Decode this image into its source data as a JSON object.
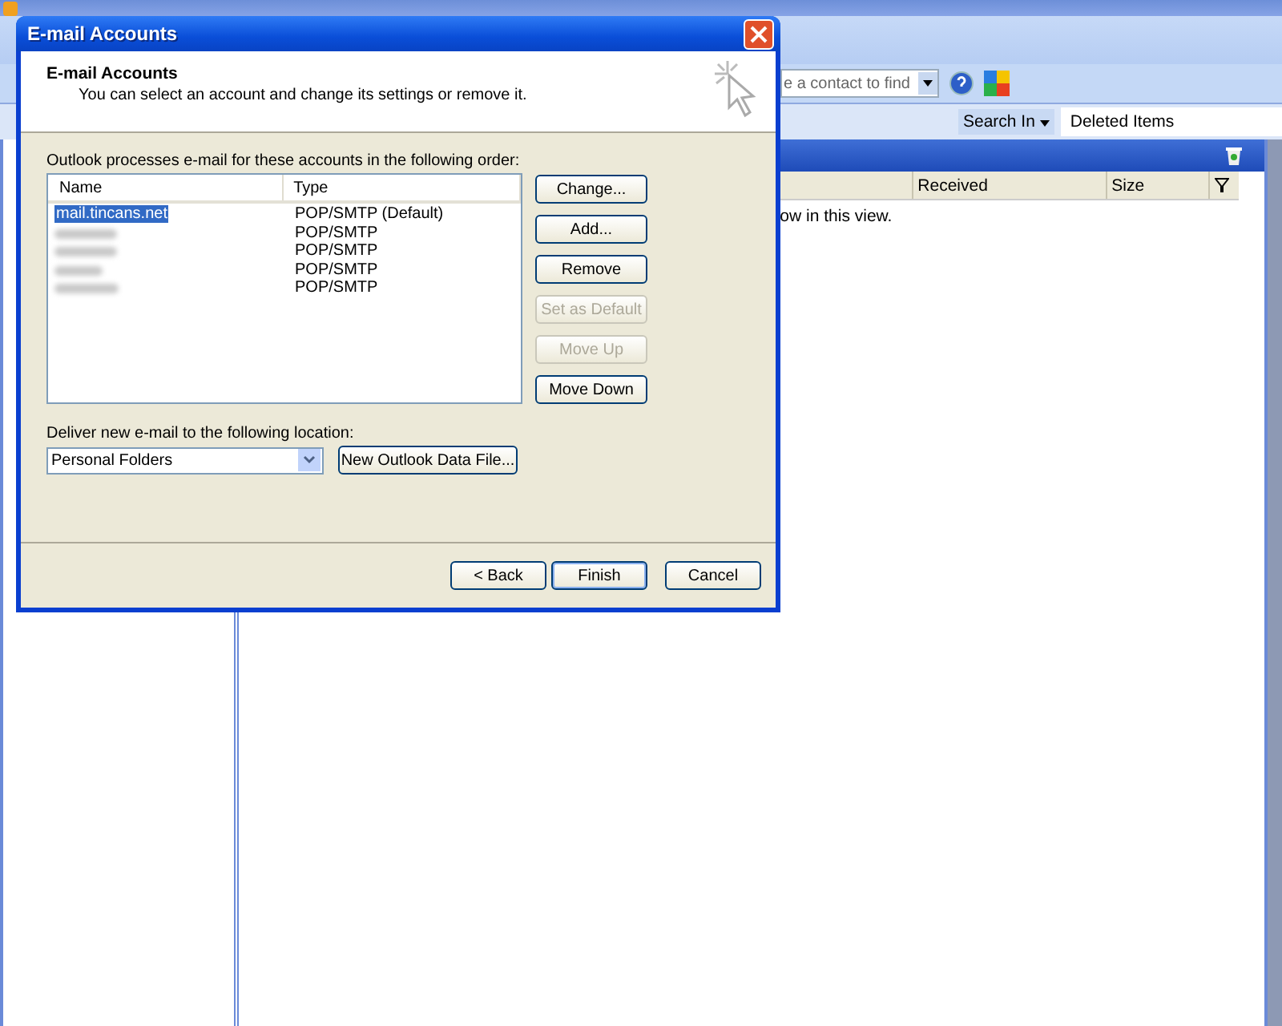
{
  "outlook": {
    "contact_search": {
      "value": "e a contact to find"
    },
    "search_in": {
      "label": "Search In",
      "scope": "Deleted Items"
    },
    "columns": [
      "Received",
      "Size"
    ],
    "empty_message": "ow in this view."
  },
  "dialog": {
    "title": "E-mail Accounts",
    "heading": "E-mail Accounts",
    "subtitle": "You can select an account and change its settings or remove it.",
    "list_label": "Outlook processes e-mail for these accounts in the following order:",
    "columns": [
      "Name",
      "Type"
    ],
    "accounts": [
      {
        "name": "mail.tincans.net",
        "type": "POP/SMTP (Default)",
        "selected": true,
        "blurred": false
      },
      {
        "type": "POP/SMTP",
        "selected": false,
        "blurred": true
      },
      {
        "type": "POP/SMTP",
        "selected": false,
        "blurred": true
      },
      {
        "type": "POP/SMTP",
        "selected": false,
        "blurred": true
      },
      {
        "type": "POP/SMTP",
        "selected": false,
        "blurred": true
      }
    ],
    "side_buttons": [
      {
        "label": "Change...",
        "disabled": false
      },
      {
        "label": "Add...",
        "disabled": false
      },
      {
        "label": "Remove",
        "disabled": false
      },
      {
        "label": "Set as Default",
        "disabled": true
      },
      {
        "label": "Move Up",
        "disabled": true
      },
      {
        "label": "Move Down",
        "disabled": false
      }
    ],
    "deliver_label": "Deliver new e-mail to the following location:",
    "deliver_value": "Personal Folders",
    "new_file_button": "New Outlook Data File...",
    "footer_buttons": [
      {
        "label": "< Back",
        "default": false
      },
      {
        "label": "Finish",
        "default": true
      },
      {
        "label": "Cancel",
        "default": false
      }
    ]
  }
}
